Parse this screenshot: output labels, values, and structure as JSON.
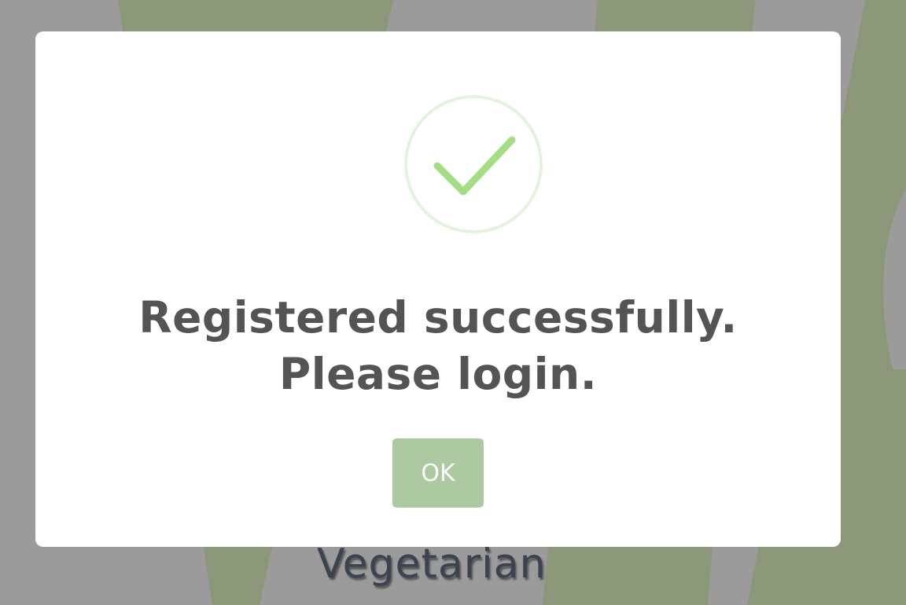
{
  "background": {
    "visible_word": "Vegetarian",
    "colors": {
      "gray": "#9b9b9b",
      "stripe_green": "#8c9779"
    }
  },
  "dialog": {
    "icon": "success-checkmark-icon",
    "message_line1": "Registered successfully.",
    "message_line2": "Please login.",
    "ok_label": "OK",
    "colors": {
      "icon_ring": "#e4f3de",
      "icon_check": "#a5dc86",
      "text": "#545454",
      "button": "#acc9a1",
      "button_text": "#ffffff"
    }
  }
}
